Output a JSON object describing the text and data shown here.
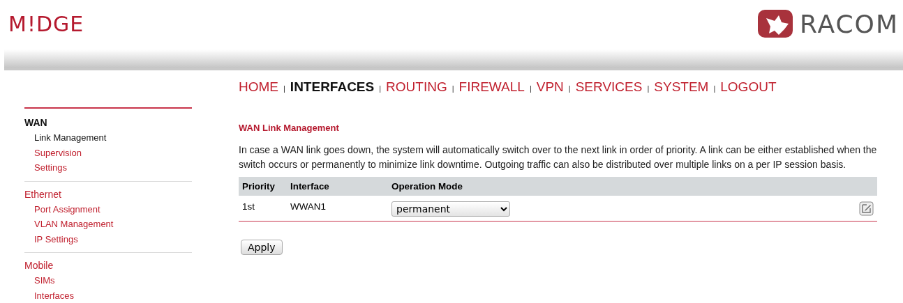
{
  "header": {
    "logo": "M!DGE",
    "brand": "RACOM"
  },
  "nav": [
    {
      "label": "HOME",
      "selected": false
    },
    {
      "label": "INTERFACES",
      "selected": true
    },
    {
      "label": "ROUTING",
      "selected": false
    },
    {
      "label": "FIREWALL",
      "selected": false
    },
    {
      "label": "VPN",
      "selected": false
    },
    {
      "label": "SERVICES",
      "selected": false
    },
    {
      "label": "SYSTEM",
      "selected": false
    },
    {
      "label": "LOGOUT",
      "selected": false
    }
  ],
  "nav_separator": "|",
  "sidebar": [
    {
      "label": "WAN",
      "selected": true,
      "children": [
        {
          "label": "Link Management",
          "selected": true
        },
        {
          "label": "Supervision",
          "selected": false
        },
        {
          "label": "Settings",
          "selected": false
        }
      ]
    },
    {
      "label": "Ethernet",
      "selected": false,
      "children": [
        {
          "label": "Port Assignment",
          "selected": false
        },
        {
          "label": "VLAN Management",
          "selected": false
        },
        {
          "label": "IP Settings",
          "selected": false
        }
      ]
    },
    {
      "label": "Mobile",
      "selected": false,
      "children": [
        {
          "label": "SIMs",
          "selected": false
        },
        {
          "label": "Interfaces",
          "selected": false
        }
      ]
    }
  ],
  "content": {
    "title": "WAN Link Management",
    "description": "In case a WAN link goes down, the system will automatically switch over to the next link in order of priority. A link can be either established when the switch occurs or permanently to minimize link downtime. Outgoing traffic can also be distributed over multiple links on a per IP session basis.",
    "table": {
      "columns": [
        "Priority",
        "Interface",
        "Operation Mode"
      ],
      "rows": [
        {
          "priority": "1st",
          "interface": "WWAN1",
          "mode": "permanent"
        }
      ]
    },
    "apply_button": "Apply"
  }
}
